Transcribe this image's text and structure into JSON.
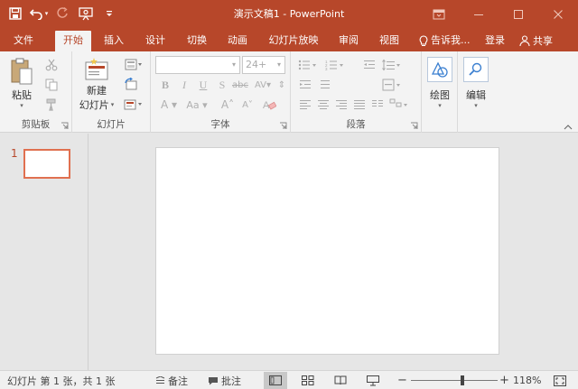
{
  "app": {
    "title": "演示文稿1 - PowerPoint",
    "accent": "#b7472a"
  },
  "qat": {
    "icons": [
      "save-icon",
      "undo-icon",
      "redo-icon",
      "start-from-beginning-icon",
      "customize-qat-icon"
    ]
  },
  "window_controls": [
    "ribbon-display-options-icon",
    "minimize-icon",
    "restore-icon",
    "close-icon"
  ],
  "tabs": [
    {
      "label": "文件"
    },
    {
      "label": "开始"
    },
    {
      "label": "插入"
    },
    {
      "label": "设计"
    },
    {
      "label": "切换"
    },
    {
      "label": "动画"
    },
    {
      "label": "幻灯片放映"
    },
    {
      "label": "审阅"
    },
    {
      "label": "视图"
    }
  ],
  "active_tab": "开始",
  "tellme": {
    "label": "告诉我..."
  },
  "signin": {
    "label": "登录"
  },
  "share": {
    "label": "共享"
  },
  "ribbon": {
    "clipboard": {
      "label": "剪贴板",
      "paste_label": "粘贴"
    },
    "slides": {
      "label": "幻灯片",
      "new_slide_line1": "新建",
      "new_slide_line2": "幻灯片"
    },
    "font": {
      "label": "字体",
      "font_name": "",
      "font_size": "24+"
    },
    "paragraph": {
      "label": "段落"
    },
    "drawing": {
      "label": "绘图"
    },
    "editing": {
      "label": "编辑"
    }
  },
  "thumbnails": [
    {
      "number": "1"
    }
  ],
  "status": {
    "slide_info": "幻灯片 第 1 张，共 1 张",
    "notes_label": "备注",
    "comments_label": "批注",
    "zoom_level": "118%",
    "zoom_fraction": 0.59
  }
}
